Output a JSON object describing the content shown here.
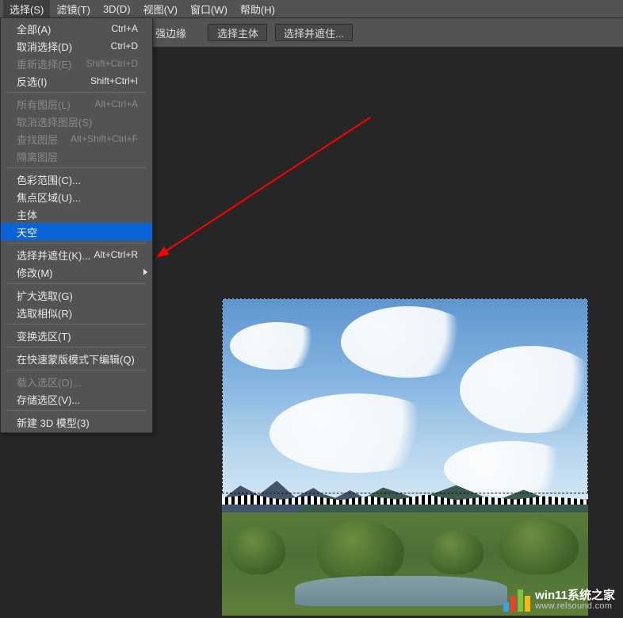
{
  "menubar": {
    "items": [
      {
        "label": "选择(S)",
        "active": true
      },
      {
        "label": "滤镜(T)"
      },
      {
        "label": "3D(D)"
      },
      {
        "label": "视图(V)"
      },
      {
        "label": "窗口(W)"
      },
      {
        "label": "帮助(H)"
      }
    ]
  },
  "optionsbar": {
    "edge_label": "强边缘",
    "buttons": [
      {
        "label": "选择主体"
      },
      {
        "label": "选择并遮住..."
      }
    ]
  },
  "dropdown": {
    "groups": [
      [
        {
          "label": "全部(A)",
          "shortcut": "Ctrl+A",
          "disabled": false
        },
        {
          "label": "取消选择(D)",
          "shortcut": "Ctrl+D",
          "disabled": false
        },
        {
          "label": "重新选择(E)",
          "shortcut": "Shift+Ctrl+D",
          "disabled": true
        },
        {
          "label": "反选(I)",
          "shortcut": "Shift+Ctrl+I",
          "disabled": false
        }
      ],
      [
        {
          "label": "所有图层(L)",
          "shortcut": "Alt+Ctrl+A",
          "disabled": true
        },
        {
          "label": "取消选择图层(S)",
          "shortcut": "",
          "disabled": true
        },
        {
          "label": "查找图层",
          "shortcut": "Alt+Shift+Ctrl+F",
          "disabled": true
        },
        {
          "label": "隔离图层",
          "shortcut": "",
          "disabled": true
        }
      ],
      [
        {
          "label": "色彩范围(C)...",
          "shortcut": "",
          "disabled": false
        },
        {
          "label": "焦点区域(U)...",
          "shortcut": "",
          "disabled": false
        },
        {
          "label": "主体",
          "shortcut": "",
          "disabled": false
        },
        {
          "label": "天空",
          "shortcut": "",
          "disabled": false,
          "highlight": true
        }
      ],
      [
        {
          "label": "选择并遮住(K)...",
          "shortcut": "Alt+Ctrl+R",
          "disabled": false
        },
        {
          "label": "修改(M)",
          "shortcut": "",
          "disabled": false,
          "submenu": true
        }
      ],
      [
        {
          "label": "扩大选取(G)",
          "shortcut": "",
          "disabled": false
        },
        {
          "label": "选取相似(R)",
          "shortcut": "",
          "disabled": false
        }
      ],
      [
        {
          "label": "变换选区(T)",
          "shortcut": "",
          "disabled": false
        }
      ],
      [
        {
          "label": "在快速蒙版模式下编辑(Q)",
          "shortcut": "",
          "disabled": false
        }
      ],
      [
        {
          "label": "载入选区(O)...",
          "shortcut": "",
          "disabled": true
        },
        {
          "label": "存储选区(V)...",
          "shortcut": "",
          "disabled": false
        }
      ],
      [
        {
          "label": "新建 3D 模型(3)",
          "shortcut": "",
          "disabled": false
        }
      ]
    ]
  },
  "watermark": {
    "line1": "win11系统之家",
    "line2": "www.relsound.com"
  }
}
